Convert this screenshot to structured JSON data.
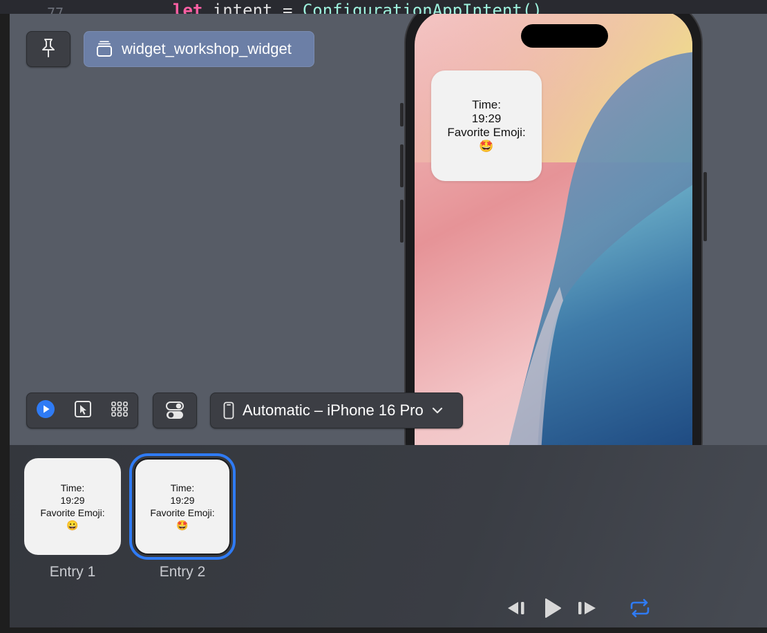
{
  "editor": {
    "line_number": "77",
    "code_keyword": "let",
    "code_name": " intent = ",
    "code_type": "ConfigurationAppIntent()"
  },
  "preview_header": {
    "widget_name": "widget_workshop_widget"
  },
  "phone_widget": {
    "time_label": "Time:",
    "time_value": "19:29",
    "emoji_label": "Favorite Emoji:",
    "emoji": "🤩"
  },
  "toolbar": {
    "device_label": "Automatic – iPhone 16 Pro",
    "active_mode": "live"
  },
  "timeline": {
    "entries": [
      {
        "label": "Entry 1",
        "time_label": "Time:",
        "time_value": "19:29",
        "emoji_label": "Favorite Emoji:",
        "emoji": "😀",
        "selected": false
      },
      {
        "label": "Entry 2",
        "time_label": "Time:",
        "time_value": "19:29",
        "emoji_label": "Favorite Emoji:",
        "emoji": "🤩",
        "selected": true
      }
    ]
  },
  "colors": {
    "accent": "#2f7bf5",
    "canvas_bg": "#575c66",
    "widget_pill_bg": "#6c7fa6"
  }
}
